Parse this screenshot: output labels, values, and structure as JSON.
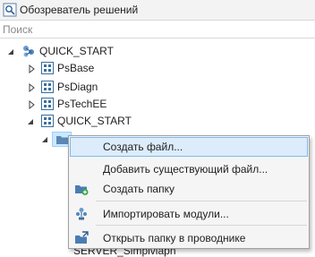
{
  "window": {
    "title": "Обозреватель решений",
    "icon": "solution-explorer-icon"
  },
  "search": {
    "placeholder": "Поиск",
    "value": ""
  },
  "tree": {
    "root": {
      "label": "QUICK_START",
      "icon": "solution-icon",
      "expanded": true
    },
    "projects": [
      {
        "label": "PsBase",
        "icon": "project-icon",
        "expanded": false
      },
      {
        "label": "PsDiagn",
        "icon": "project-icon",
        "expanded": false
      },
      {
        "label": "PsTechEE",
        "icon": "project-icon",
        "expanded": false
      },
      {
        "label": "QUICK_START",
        "icon": "project-icon",
        "expanded": true
      }
    ],
    "selected_child": {
      "icon": "folder-icon"
    },
    "partial_item": {
      "label": "SERVER_Simplvlapn"
    }
  },
  "context_menu": {
    "items": [
      {
        "label": "Создать файл...",
        "icon": "",
        "highlighted": true
      },
      {
        "label": "Добавить существующий файл...",
        "icon": ""
      },
      {
        "label": "Создать папку",
        "icon": "new-folder-icon"
      },
      {
        "label": "Импортировать модули...",
        "icon": "import-modules-icon"
      },
      {
        "label": "Открыть папку в проводнике",
        "icon": "open-in-explorer-icon"
      }
    ]
  },
  "colors": {
    "selection": "#cce8ff",
    "menu_highlight": "#dcecfb",
    "project_icon": "#3b6f9e"
  }
}
